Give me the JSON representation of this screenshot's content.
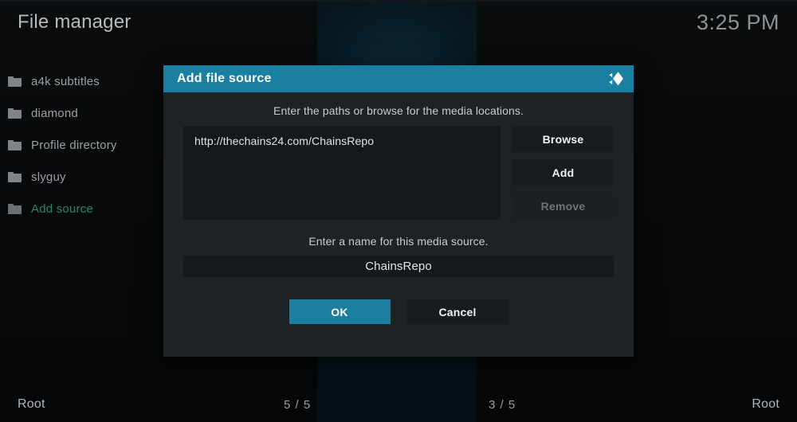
{
  "header": {
    "title": "File manager",
    "clock": "3:25 PM"
  },
  "sidebar": {
    "items": [
      {
        "label": "a4k subtitles",
        "icon": "folder-icon",
        "accent": false
      },
      {
        "label": "diamond",
        "icon": "folder-icon",
        "accent": false
      },
      {
        "label": "Profile directory",
        "icon": "folder-icon",
        "accent": false
      },
      {
        "label": "slyguy",
        "icon": "folder-icon",
        "accent": false
      },
      {
        "label": "Add source",
        "icon": "folder-icon",
        "accent": true
      }
    ]
  },
  "dialog": {
    "title": "Add file source",
    "logo_icon": "kodi-logo-icon",
    "paths_hint": "Enter the paths or browse for the media locations.",
    "paths": [
      "http://thechains24.com/ChainsRepo"
    ],
    "buttons": {
      "browse": "Browse",
      "add": "Add",
      "remove": "Remove"
    },
    "name_hint": "Enter a name for this media source.",
    "name_value": "ChainsRepo",
    "actions": {
      "ok": "OK",
      "cancel": "Cancel"
    }
  },
  "statusbar": {
    "left_path": "Root",
    "left_count": "5 / 5",
    "right_count": "3 / 5",
    "right_path": "Root"
  },
  "colors": {
    "accent_teal": "#1a7fa0",
    "accent_green": "#268a60",
    "dialog_bg": "#1d2226",
    "field_bg": "#14191c",
    "button_bg": "#171c1f",
    "text_primary": "#dfe3e4",
    "text_muted": "#9aa0a2",
    "text_disabled": "#6d7477"
  }
}
